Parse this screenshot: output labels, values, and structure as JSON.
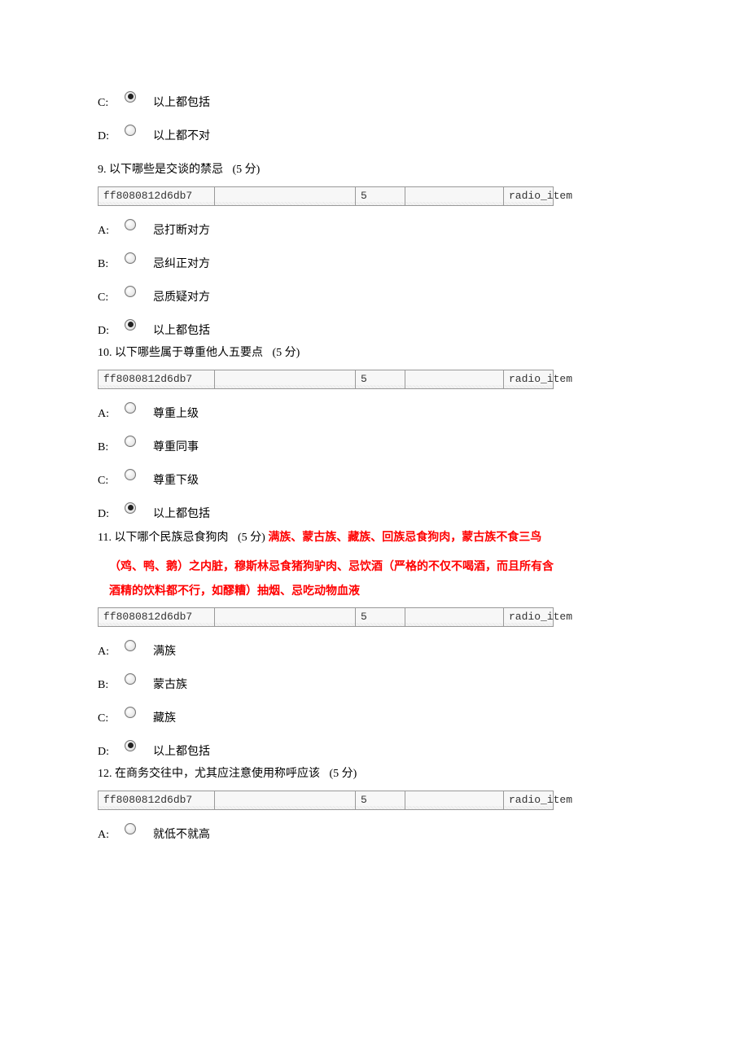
{
  "frag": {
    "C": {
      "label": "C:",
      "text": "以上都包括",
      "selected": true
    },
    "D": {
      "label": "D:",
      "text": "以上都不对",
      "selected": false
    }
  },
  "questions": [
    {
      "num": "9.",
      "text": "以下哪些是交谈的禁忌",
      "points": "(5 分)",
      "meta": {
        "id": "ff8080812d6db7",
        "val": "5",
        "type": "radio_item"
      },
      "options": [
        {
          "label": "A:",
          "text": "忌打断对方",
          "selected": false
        },
        {
          "label": "B:",
          "text": "忌纠正对方",
          "selected": false
        },
        {
          "label": "C:",
          "text": "忌质疑对方",
          "selected": false
        },
        {
          "label": "D:",
          "text": "以上都包括",
          "selected": true
        }
      ]
    },
    {
      "num": "10.",
      "text": "以下哪些属于尊重他人五要点",
      "points": "(5 分)",
      "meta": {
        "id": "ff8080812d6db7",
        "val": "5",
        "type": "radio_item"
      },
      "options": [
        {
          "label": "A:",
          "text": "尊重上级",
          "selected": false
        },
        {
          "label": "B:",
          "text": "尊重同事",
          "selected": false
        },
        {
          "label": "C:",
          "text": "尊重下级",
          "selected": false
        },
        {
          "label": "D:",
          "text": "以上都包括",
          "selected": true
        }
      ]
    },
    {
      "num": "11.",
      "text": "以下哪个民族忌食狗肉",
      "points": "(5 分)",
      "annotation_inline": "满族、蒙古族、藏族、回族忌食狗肉，蒙古族不食三鸟",
      "annotation_lines": [
        "（鸡、鸭、鹅）之内脏，穆斯林忌食猪狗驴肉、忌饮酒（严格的不仅不喝酒，而且所有含",
        "酒精的饮料都不行，如醪糟）抽烟、忌吃动物血液"
      ],
      "meta": {
        "id": "ff8080812d6db7",
        "val": "5",
        "type": "radio_item"
      },
      "options": [
        {
          "label": "A:",
          "text": "满族",
          "selected": false
        },
        {
          "label": "B:",
          "text": "蒙古族",
          "selected": false
        },
        {
          "label": "C:",
          "text": "藏族",
          "selected": false
        },
        {
          "label": "D:",
          "text": "以上都包括",
          "selected": true
        }
      ]
    },
    {
      "num": "12.",
      "text": "在商务交往中，尤其应注意使用称呼应该",
      "points": "(5 分)",
      "meta": {
        "id": "ff8080812d6db7",
        "val": "5",
        "type": "radio_item"
      },
      "options": [
        {
          "label": "A:",
          "text": "就低不就高",
          "selected": false
        }
      ]
    }
  ]
}
